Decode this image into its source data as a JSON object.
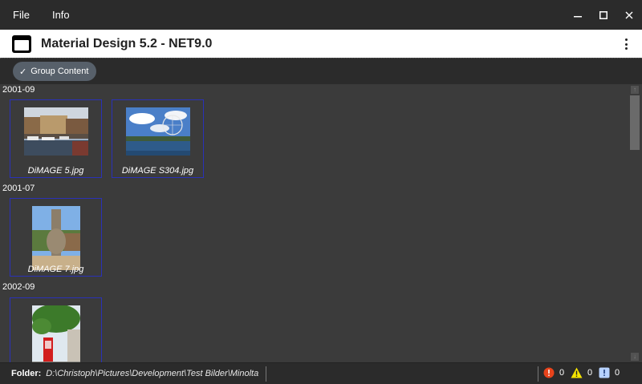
{
  "menu": {
    "file_label": "File",
    "info_label": "Info"
  },
  "appbar": {
    "title": "Material Design 5.2 - NET9.0"
  },
  "toolbar": {
    "group_chip_label": "Group Content"
  },
  "groups": [
    {
      "label": "2001-09",
      "items": [
        {
          "caption": "DiMAGE 5.jpg"
        },
        {
          "caption": "DiMAGE S304.jpg"
        }
      ]
    },
    {
      "label": "2001-07",
      "items": [
        {
          "caption": "DiMAGE 7.jpg"
        }
      ]
    },
    {
      "label": "2002-09",
      "items": [
        {
          "caption": ""
        }
      ]
    }
  ],
  "status": {
    "folder_label": "Folder:",
    "folder_path": "D:\\Christoph\\Pictures\\Development\\Test Bilder\\Minolta",
    "error_count": "0",
    "warning_count": "0",
    "info_count": "0"
  },
  "colors": {
    "error": "#e8431b",
    "warning": "#f5e400",
    "info": "#b7d2ff",
    "tile_border": "#2a31b8"
  },
  "icons": [
    "app-window-icon",
    "more-vert-icon",
    "minimize-icon",
    "maximize-icon",
    "close-icon",
    "check-icon",
    "error-icon",
    "warning-icon",
    "info-icon"
  ]
}
